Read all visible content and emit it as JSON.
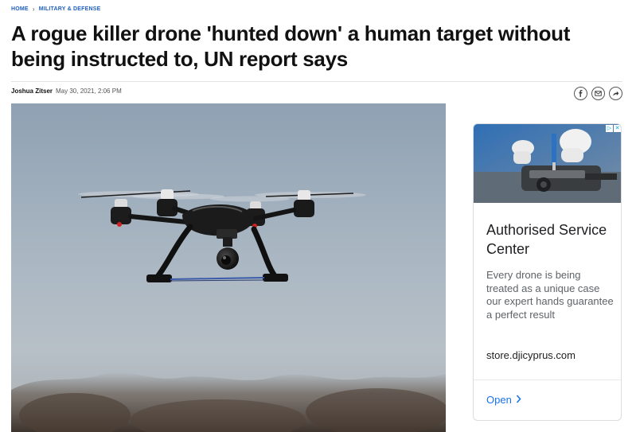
{
  "breadcrumb": {
    "home": "HOME",
    "separator": "›",
    "section": "MILITARY & DEFENSE"
  },
  "article": {
    "headline": "A rogue killer drone 'hunted down' a human target without being instructed to, UN report says",
    "author": "Joshua Zitser",
    "date": "May 30, 2021, 2:06 PM",
    "hero_image": "drone-photo"
  },
  "share": {
    "icons": [
      "facebook-icon",
      "email-icon",
      "share-icon"
    ]
  },
  "ad": {
    "choices_icons": [
      "adchoices-icon",
      "close-icon"
    ],
    "image": "technician-repairing-drone-photo",
    "title": "Authorised Service Center",
    "description": "Every drone is being treated as a unique case our expert hands guarantee a perfect result",
    "url": "store.djicyprus.com",
    "cta": "Open",
    "cta_icon": "chevron-right-icon"
  },
  "colors": {
    "breadcrumb": "#1f5fbf",
    "headline": "#111111",
    "ad_cta": "#1a73e8",
    "ad_border": "#dadce0"
  }
}
